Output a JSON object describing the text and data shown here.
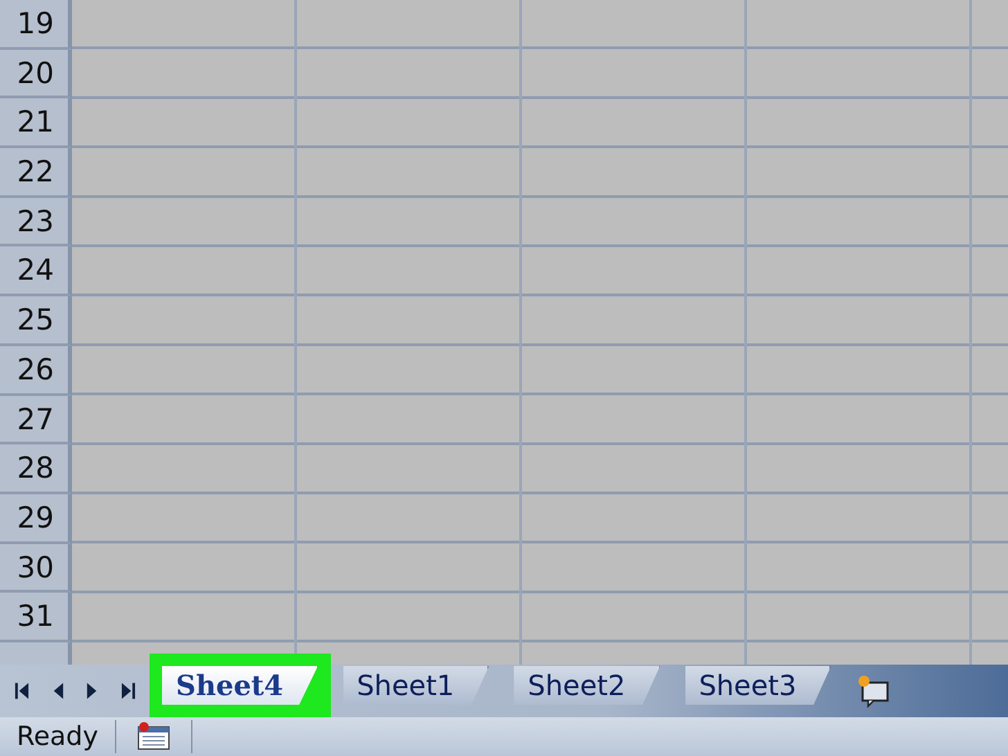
{
  "row_headers": [
    "19",
    "20",
    "21",
    "22",
    "23",
    "24",
    "25",
    "26",
    "27",
    "28",
    "29",
    "30",
    "31"
  ],
  "sheet_tabs": [
    {
      "label": "Sheet4",
      "selected": true,
      "highlighted": true
    },
    {
      "label": "Sheet1",
      "selected": false,
      "highlighted": false
    },
    {
      "label": "Sheet2",
      "selected": false,
      "highlighted": false
    },
    {
      "label": "Sheet3",
      "selected": false,
      "highlighted": false
    }
  ],
  "status_bar": {
    "text": "Ready"
  }
}
